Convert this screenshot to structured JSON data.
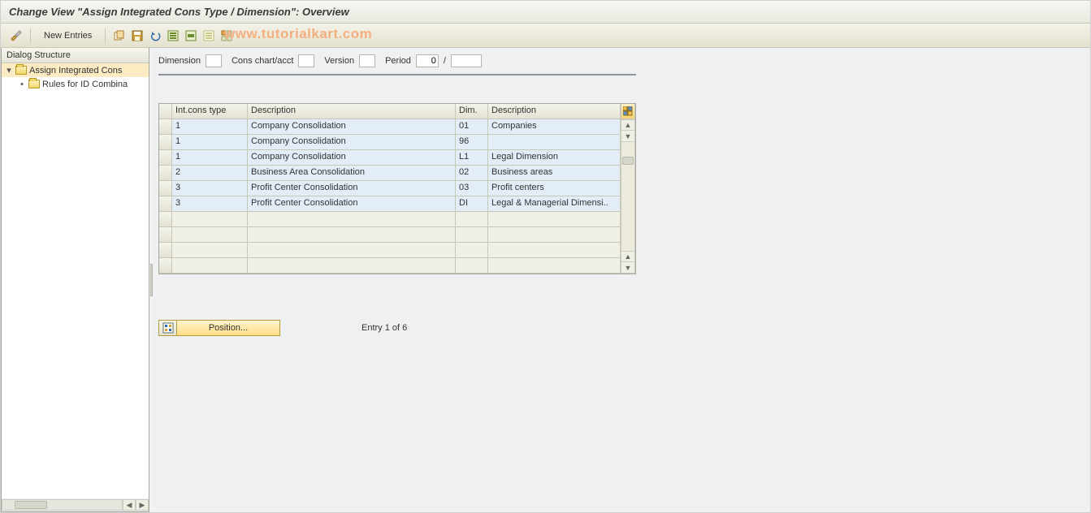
{
  "title": "Change View \"Assign Integrated Cons Type / Dimension\": Overview",
  "toolbar": {
    "new_entries_label": "New Entries"
  },
  "watermark": "www.tutorialkart.com",
  "tree": {
    "header": "Dialog Structure",
    "items": [
      {
        "label": "Assign Integrated Cons",
        "selected": true,
        "level": 0,
        "open": true
      },
      {
        "label": "Rules for ID Combina",
        "selected": false,
        "level": 1,
        "open": false
      }
    ]
  },
  "filters": {
    "dimension": {
      "label": "Dimension",
      "value": ""
    },
    "cons_chart": {
      "label": "Cons chart/acct",
      "value": ""
    },
    "version": {
      "label": "Version",
      "value": ""
    },
    "period": {
      "label": "Period",
      "value_a": "0",
      "value_b": ""
    }
  },
  "table": {
    "columns": {
      "int_cons_type": "Int.cons type",
      "description1": "Description",
      "dim": "Dim.",
      "description2": "Description"
    },
    "rows": [
      {
        "type": "1",
        "desc1": "Company Consolidation",
        "dim": "01",
        "desc2": "Companies"
      },
      {
        "type": "1",
        "desc1": "Company Consolidation",
        "dim": "96",
        "desc2": ""
      },
      {
        "type": "1",
        "desc1": "Company Consolidation",
        "dim": "L1",
        "desc2": "Legal Dimension"
      },
      {
        "type": "2",
        "desc1": "Business Area Consolidation",
        "dim": "02",
        "desc2": "Business areas"
      },
      {
        "type": "3",
        "desc1": "Profit Center Consolidation",
        "dim": "03",
        "desc2": "Profit centers"
      },
      {
        "type": "3",
        "desc1": "Profit Center Consolidation",
        "dim": "DI",
        "desc2": "Legal & Managerial Dimensi.."
      }
    ],
    "empty_rows": 4
  },
  "footer": {
    "position_label": "Position...",
    "entry_text": "Entry 1 of 6"
  }
}
